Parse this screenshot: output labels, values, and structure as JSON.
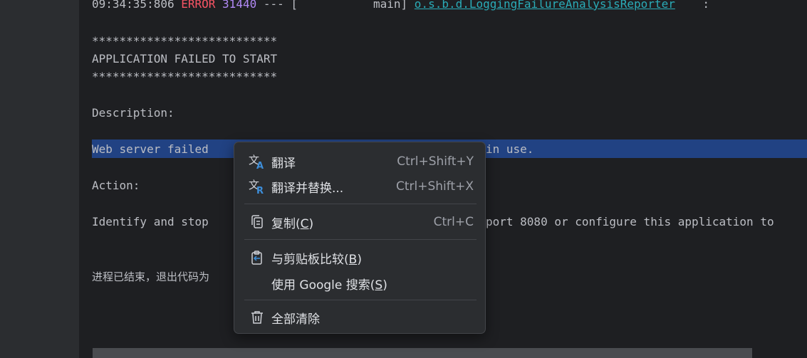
{
  "console": {
    "log_time": "09:34:35:806",
    "log_level": "ERROR",
    "log_pid": "31440",
    "log_sep": "--- [",
    "log_thread": "           main]",
    "log_logger": "o.s.b.d.LoggingFailureAnalysisReporter",
    "log_colon": ":",
    "stars1": "***************************",
    "title": "APPLICATION FAILED TO START",
    "stars2": "***************************",
    "description_label": "Description:",
    "desc_start": "Web server failed ",
    "desc_end": "in use.",
    "action_label": "Action:",
    "action_start": "Identify and stop ",
    "action_end": "port 8080 or configure this application to",
    "exit_text": "进程已结束，退出代码为"
  },
  "context_menu": {
    "items": [
      {
        "label": "翻译",
        "shortcut": "Ctrl+Shift+Y",
        "icon": "translate-icon"
      },
      {
        "label": "翻译并替换...",
        "shortcut": "Ctrl+Shift+X",
        "icon": "translate-replace-icon"
      },
      {
        "label_main": "复制(",
        "mnemonic": "C",
        "label_end": ")",
        "shortcut": "Ctrl+C",
        "icon": "copy-icon"
      },
      {
        "label_main": "与剪贴板比较(",
        "mnemonic": "B",
        "label_end": ")",
        "icon": "compare-clipboard-icon"
      },
      {
        "label_main": "使用 Google 搜索(",
        "mnemonic": "S",
        "label_end": ")"
      },
      {
        "label": "全部清除",
        "icon": "trash-icon"
      }
    ]
  },
  "colors": {
    "background": "#1e1f22",
    "selection": "#214283",
    "error": "#f75464",
    "pid": "#b189f5",
    "logger": "#2aacb8",
    "menu_bg": "#2b2d30"
  }
}
